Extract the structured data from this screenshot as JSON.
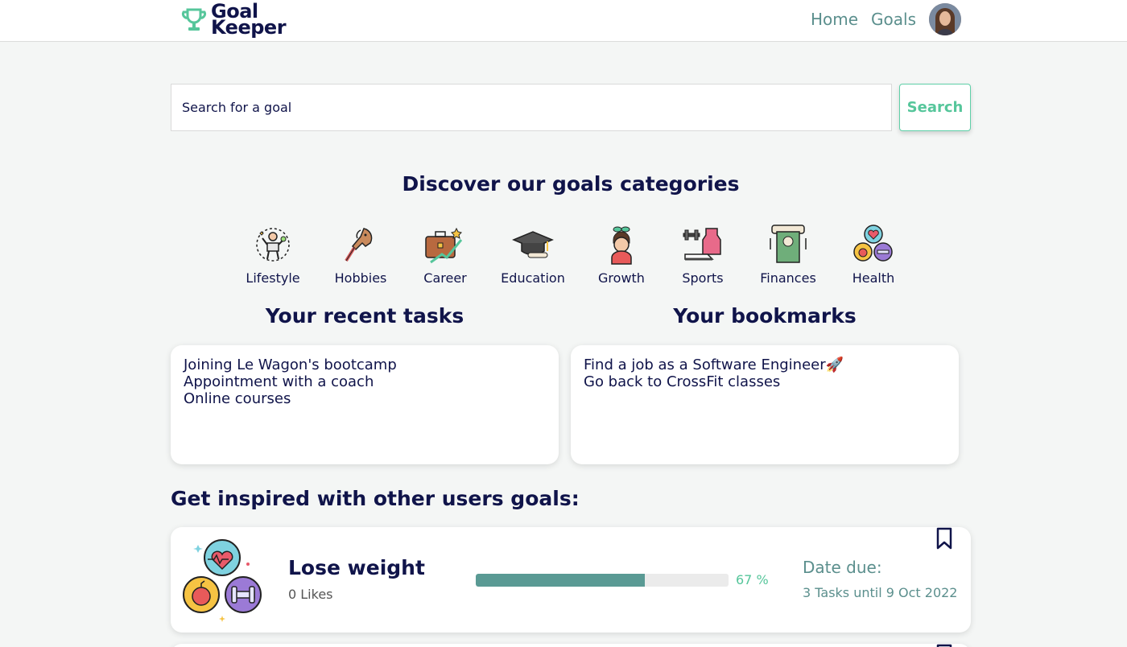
{
  "navbar": {
    "logo_line1": "Goal",
    "logo_line2": "Keeper",
    "links": [
      {
        "label": "Home"
      },
      {
        "label": "Goals"
      }
    ]
  },
  "search": {
    "placeholder": "Search for a goal",
    "button_label": "Search"
  },
  "categories": {
    "title": "Discover our goals categories",
    "items": [
      {
        "label": "Lifestyle",
        "icon": "lifestyle-icon"
      },
      {
        "label": "Hobbies",
        "icon": "hobby-horse-icon"
      },
      {
        "label": "Career",
        "icon": "briefcase-icon"
      },
      {
        "label": "Education",
        "icon": "graduation-cap-icon"
      },
      {
        "label": "Growth",
        "icon": "sprout-head-icon"
      },
      {
        "label": "Sports",
        "icon": "sports-gear-icon"
      },
      {
        "label": "Finances",
        "icon": "atm-money-icon"
      },
      {
        "label": "Health",
        "icon": "health-icon"
      }
    ]
  },
  "recent_tasks": {
    "title": "Your recent tasks",
    "items": [
      "Joining Le Wagon's bootcamp",
      "Appointment with a coach",
      "Online courses"
    ]
  },
  "bookmarks": {
    "title": "Your bookmarks",
    "items": [
      "Find a job as a Software Engineer🚀",
      "Go back to CrossFit classes"
    ]
  },
  "inspired": {
    "title": "Get inspired with other users goals:",
    "goals": [
      {
        "title": "Lose weight",
        "likes": "0 Likes",
        "progress": 67,
        "progress_label": "67 %",
        "date_label": "Date due:",
        "date_value": "3 Tasks until 9 Oct 2022",
        "icon": "health-icon"
      }
    ]
  },
  "colors": {
    "navy": "#10144a",
    "teal": "#5b8f8d",
    "mint": "#56c69b",
    "progress": "#5a9a94"
  }
}
